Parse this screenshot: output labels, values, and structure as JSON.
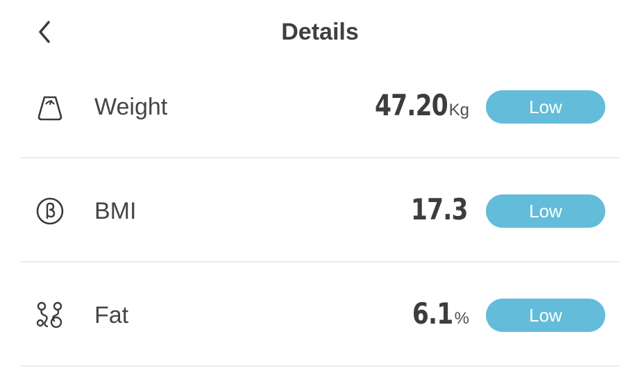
{
  "header": {
    "title": "Details"
  },
  "rows": [
    {
      "icon": "weight-scale-icon",
      "label": "Weight",
      "value": "47.20",
      "unit": "Kg",
      "status": "Low"
    },
    {
      "icon": "bmi-icon",
      "label": "BMI",
      "value": "17.3",
      "unit": "",
      "status": "Low"
    },
    {
      "icon": "body-fat-icon",
      "label": "Fat",
      "value": "6.1",
      "unit": "%",
      "status": "Low"
    }
  ],
  "colors": {
    "badge": "#63bcd9",
    "divider": "#ececec",
    "text": "#404040"
  }
}
